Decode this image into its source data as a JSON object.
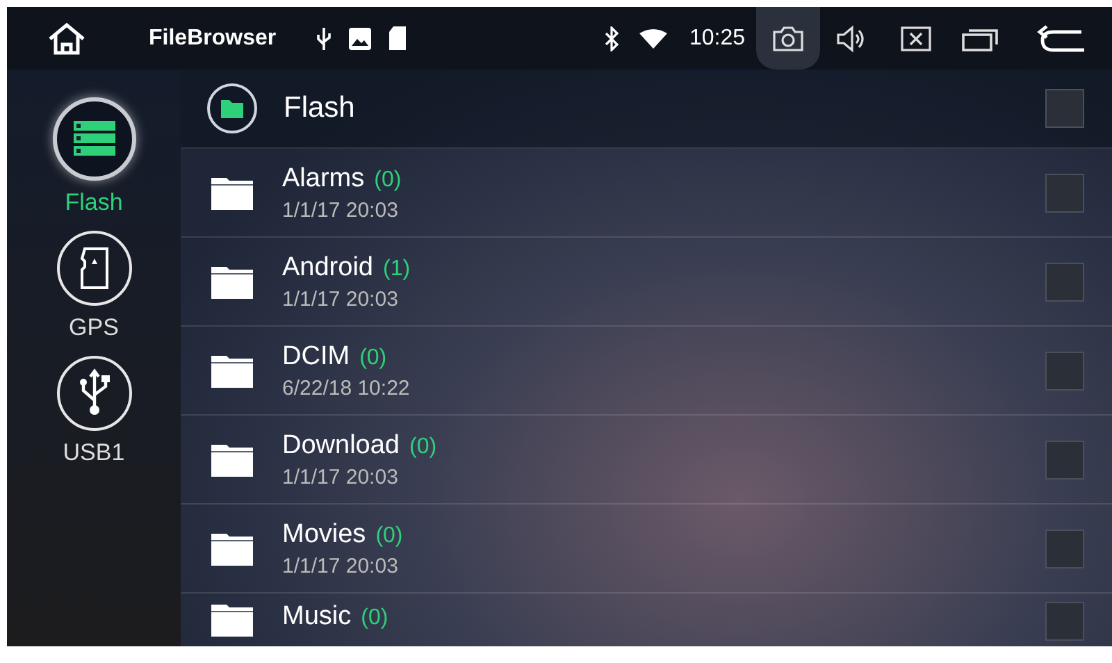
{
  "status_bar": {
    "app_title": "FileBrowser",
    "time": "10:25",
    "buttons": [
      {
        "kind": "camera",
        "selected": true
      },
      {
        "kind": "volume",
        "selected": false
      },
      {
        "kind": "close",
        "selected": false
      },
      {
        "kind": "windows",
        "selected": false
      },
      {
        "kind": "back",
        "selected": false
      }
    ]
  },
  "sidebar": {
    "items": [
      {
        "label": "Flash",
        "kind": "flash",
        "selected": true
      },
      {
        "label": "GPS",
        "kind": "sd",
        "selected": false
      },
      {
        "label": "USB1",
        "kind": "usb",
        "selected": false
      }
    ]
  },
  "list": {
    "header": {
      "title": "Flash",
      "checked": false
    },
    "rows": [
      {
        "name": "Alarms",
        "count": "(0)",
        "date": "1/1/17 20:03",
        "checked": false
      },
      {
        "name": "Android",
        "count": "(1)",
        "date": "1/1/17 20:03",
        "checked": false
      },
      {
        "name": "DCIM",
        "count": "(0)",
        "date": "6/22/18 10:22",
        "checked": false
      },
      {
        "name": "Download",
        "count": "(0)",
        "date": "1/1/17 20:03",
        "checked": false
      },
      {
        "name": "Movies",
        "count": "(0)",
        "date": "1/1/17 20:03",
        "checked": false
      },
      {
        "name": "Music",
        "count": "(0)",
        "checked": false
      }
    ]
  }
}
